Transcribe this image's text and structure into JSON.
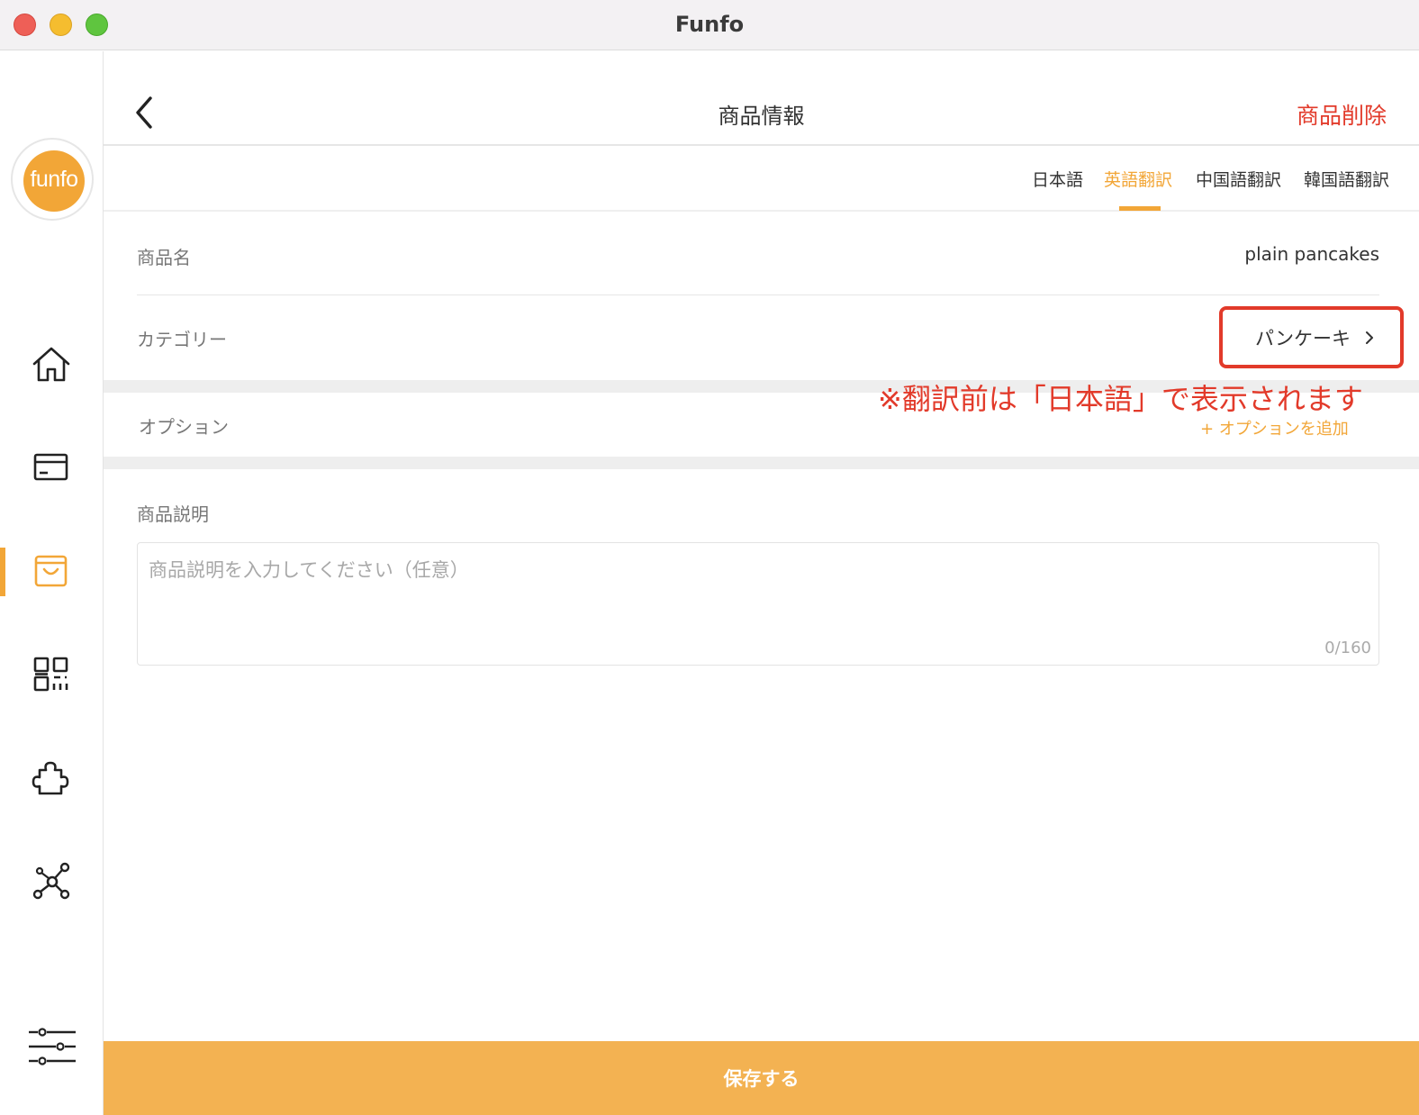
{
  "window": {
    "title": "Funfo"
  },
  "sidebar": {
    "logo_text": "funfo",
    "items": [
      {
        "name": "home",
        "icon": "home-icon"
      },
      {
        "name": "orders",
        "icon": "card-icon"
      },
      {
        "name": "products",
        "icon": "shopping-bag-icon",
        "active": true
      },
      {
        "name": "qr",
        "icon": "qr-code-icon"
      },
      {
        "name": "plugins",
        "icon": "puzzle-icon"
      },
      {
        "name": "network",
        "icon": "network-icon"
      }
    ],
    "settings_icon": "sliders-icon"
  },
  "header": {
    "title": "商品情報",
    "delete_label": "商品削除"
  },
  "tabs": [
    {
      "label": "日本語",
      "active": false
    },
    {
      "label": "英語翻訳",
      "active": true
    },
    {
      "label": "中国語翻訳",
      "active": false
    },
    {
      "label": "韓国語翻訳",
      "active": false
    }
  ],
  "form": {
    "product_name_label": "商品名",
    "product_name_value": "plain pancakes",
    "category_label": "カテゴリー",
    "category_value": "パンケーキ",
    "annotation": "※翻訳前は「日本語」で表示されます",
    "option_label": "オプション",
    "add_option_label": "+ オプションを追加",
    "description_label": "商品説明",
    "description_placeholder": "商品説明を入力してください（任意）",
    "description_count": "0/160"
  },
  "footer": {
    "save_label": "保存する"
  },
  "colors": {
    "accent": "#f2a637",
    "danger": "#e23a2a"
  }
}
